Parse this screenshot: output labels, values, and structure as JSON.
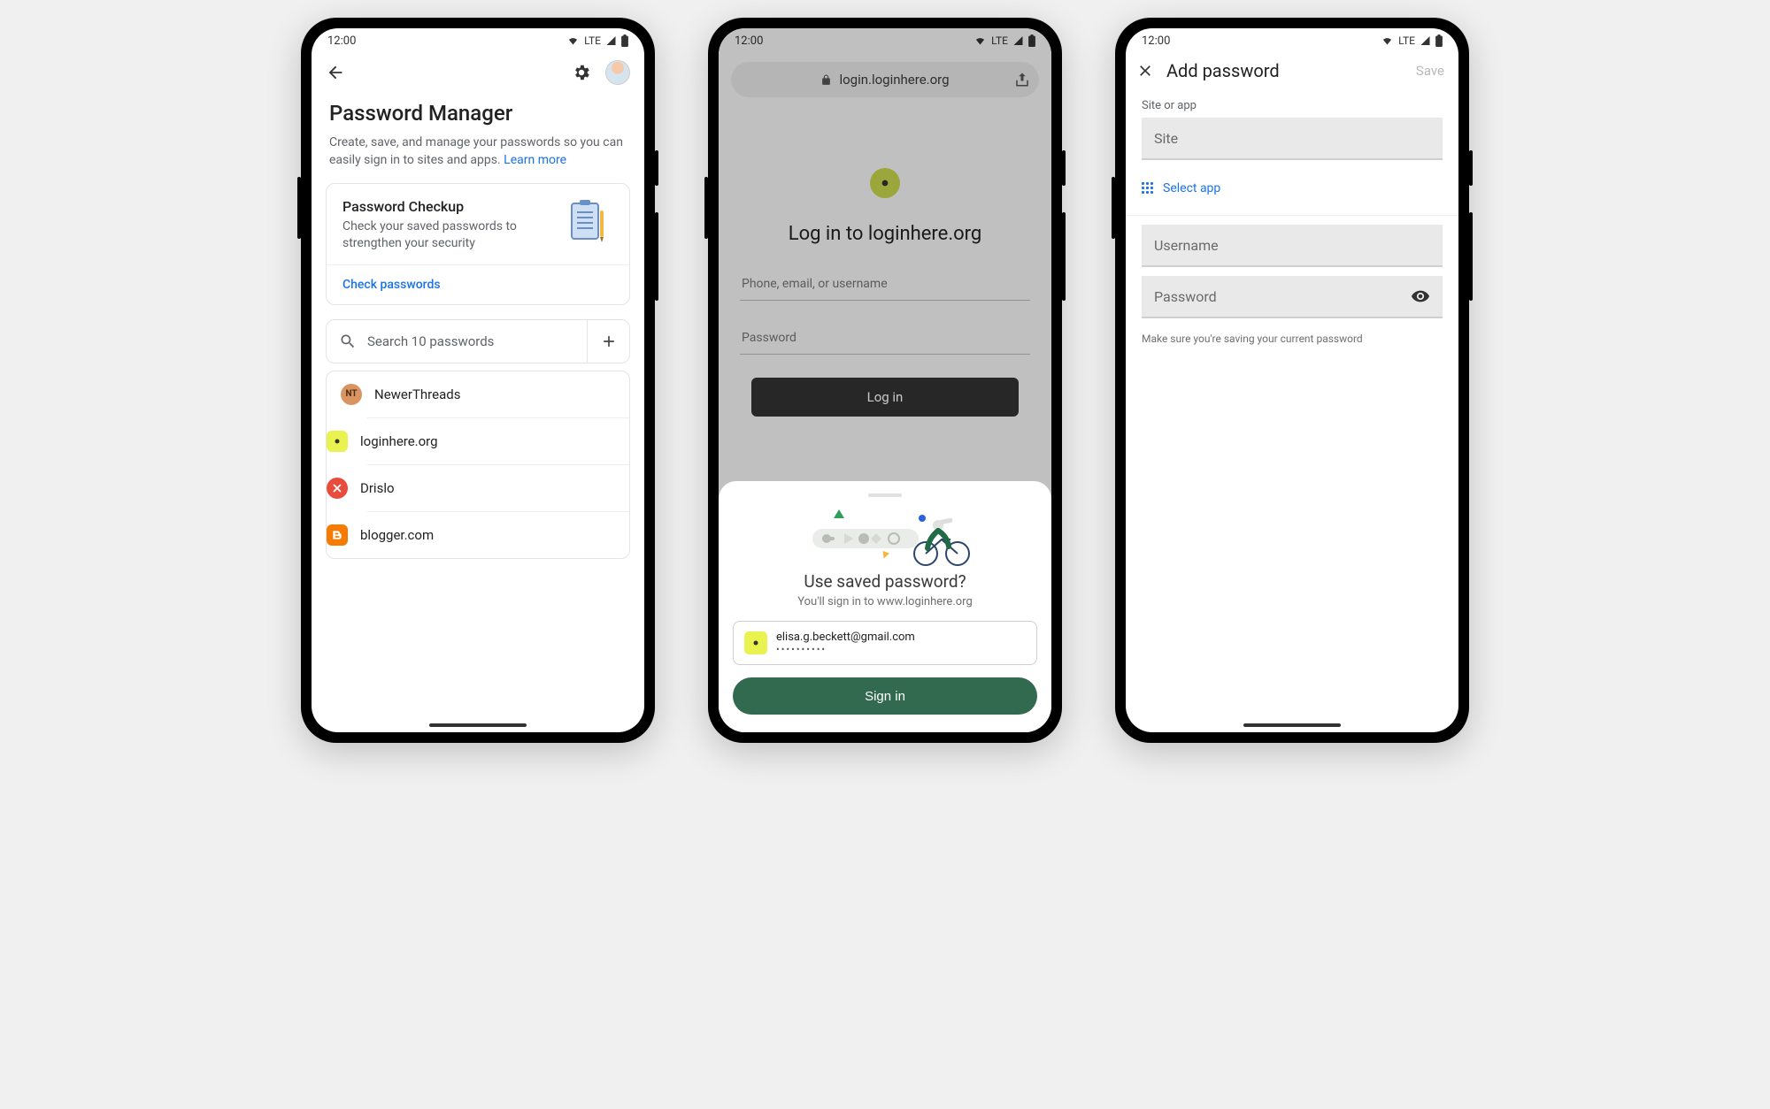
{
  "status": {
    "time": "12:00",
    "network": "LTE"
  },
  "screen1": {
    "title": "Password Manager",
    "subtitle": "Create, save, and manage your passwords so you can easily sign in to sites and apps.",
    "learn_more": "Learn more",
    "checkup": {
      "title": "Password Checkup",
      "subtitle": "Check your saved passwords to strengthen your security",
      "action": "Check passwords"
    },
    "search_placeholder": "Search 10 passwords",
    "entries": [
      "NewerThreads",
      "loginhere.org",
      "Drislo",
      "blogger.com"
    ]
  },
  "screen2": {
    "url": "login.loginhere.org",
    "page_title": "Log in to loginhere.org",
    "field1_placeholder": "Phone, email, or username",
    "field2_placeholder": "Password",
    "page_login_btn": "Log in",
    "sheet_title": "Use saved password?",
    "sheet_sub": "You'll sign in to www.loginhere.org",
    "cred_email": "elisa.g.beckett@gmail.com",
    "cred_pw": "••••••••••",
    "signin": "Sign in"
  },
  "screen3": {
    "title": "Add password",
    "save": "Save",
    "label_site": "Site or app",
    "ph_site": "Site",
    "select_app": "Select app",
    "ph_user": "Username",
    "ph_pass": "Password",
    "helper": "Make sure you're saving your current password"
  }
}
